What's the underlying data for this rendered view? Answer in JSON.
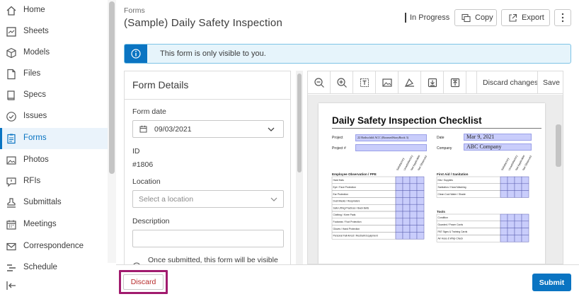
{
  "sidebar": {
    "items": [
      {
        "label": "Home",
        "icon": "home-icon",
        "active": false
      },
      {
        "label": "Sheets",
        "icon": "sheets-icon",
        "active": false
      },
      {
        "label": "Models",
        "icon": "cube-icon",
        "active": false
      },
      {
        "label": "Files",
        "icon": "file-icon",
        "active": false
      },
      {
        "label": "Specs",
        "icon": "book-icon",
        "active": false
      },
      {
        "label": "Issues",
        "icon": "check-circle-icon",
        "active": false
      },
      {
        "label": "Forms",
        "icon": "clipboard-icon",
        "active": true
      },
      {
        "label": "Photos",
        "icon": "image-icon",
        "active": false
      },
      {
        "label": "RFIs",
        "icon": "speech-bubble-icon",
        "active": false
      },
      {
        "label": "Submittals",
        "icon": "stamp-icon",
        "active": false
      },
      {
        "label": "Meetings",
        "icon": "calendar-icon",
        "active": false
      },
      {
        "label": "Correspondence",
        "icon": "mail-icon",
        "active": false
      },
      {
        "label": "Schedule",
        "icon": "list-icon",
        "active": false
      }
    ]
  },
  "header": {
    "breadcrumb": "Forms",
    "title": "(Sample) Daily Safety Inspection",
    "status": "In Progress",
    "copy_label": "Copy",
    "export_label": "Export"
  },
  "banner": {
    "text": "This form is only visible to you.",
    "color": "#0a74c2"
  },
  "form_details": {
    "title": "Form Details",
    "form_date_label": "Form date",
    "form_date_value": "09/03/2021",
    "id_label": "ID",
    "id_value": "#1806",
    "location_label": "Location",
    "location_placeholder": "Select a location",
    "description_label": "Description",
    "note": "Once submitted, this form will be visible"
  },
  "viewer": {
    "discard_changes_label": "Discard changes",
    "save_label": "Save",
    "tools": [
      "zoom-out-icon",
      "zoom-in-icon",
      "text-box-icon",
      "image-icon",
      "draw-icon",
      "download-icon",
      "upload-icon"
    ]
  },
  "document": {
    "title": "Daily Safety Inspection Checklist",
    "project_label": "Project",
    "project_value": "22 Rothschild ACC (RoomedStoryBook 3)",
    "project_num_label": "Project #",
    "date_label": "Date",
    "date_value": "Mar 9, 2021",
    "company_label": "Company",
    "company_value": "ABC Company",
    "section_ppe": "Employee Observation / PPE",
    "ppe_items": [
      "Hard Hats",
      "Eye / Face Protection",
      "Ear Protection",
      "Dust Masks / Respirators",
      "Safe Lifting Practices / Back Belts",
      "Clothing / Knee Pads",
      "Footwear / Foot Protection",
      "Gloves / Hand Protection",
      "Personal Fall Arrest / Restraint Equipment"
    ],
    "section_first_aid": "First Aid / Sanitation",
    "first_aid_items": [
      "Kits / Supplies",
      "Sanitation / Hand Washing",
      "Clean Cool Water / Shade"
    ],
    "section_tools": "Tools",
    "tools_items": [
      "Condition",
      "Guarded / Power Cords",
      "PAT Signs & Training Cards",
      "Air Hose & Whip Check"
    ],
    "column_heads": [
      "Satisfactory",
      "Unsatisfactory",
      "Not Applicable",
      "Not Observed"
    ],
    "field_color": "#c9cdfb"
  },
  "footer": {
    "discard_label": "Discard",
    "submit_label": "Submit",
    "highlight_color": "#a11b6e",
    "submit_color": "#0a74c2"
  }
}
